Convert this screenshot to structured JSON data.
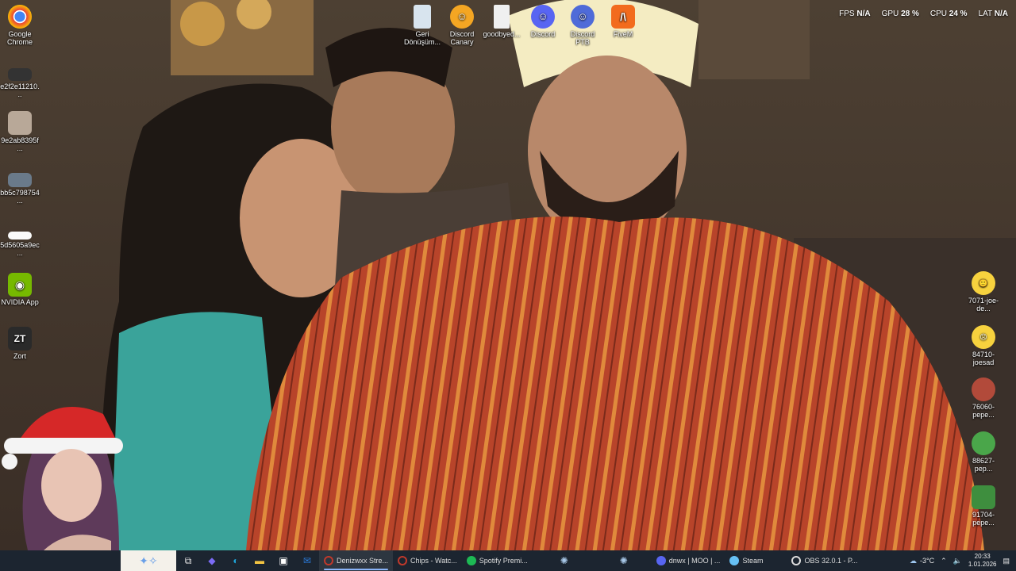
{
  "desktop": {
    "left_icons": [
      {
        "label": "Google Chrome",
        "icon": "chrome-icon"
      },
      {
        "label": "e2f2e11210...",
        "icon": "image-file-icon"
      },
      {
        "label": "9e2ab8395f...",
        "icon": "image-file-icon"
      },
      {
        "label": "bb5c798754...",
        "icon": "image-file-icon"
      },
      {
        "label": "5d5605a9ec...",
        "icon": "image-file-icon"
      },
      {
        "label": "NVIDIA App",
        "icon": "nvidia-icon"
      },
      {
        "label": "Zort",
        "icon": "zort-icon"
      }
    ],
    "top_icons": [
      {
        "label": "Geri Dönüşüm...",
        "icon": "recycle-bin-icon"
      },
      {
        "label": "Discord Canary",
        "icon": "discord-canary-icon"
      },
      {
        "label": "goodbyed...",
        "icon": "file-icon"
      },
      {
        "label": "Discord",
        "icon": "discord-icon"
      },
      {
        "label": "Discord PTB",
        "icon": "discord-ptb-icon"
      },
      {
        "label": "FiveM",
        "icon": "fivem-icon"
      }
    ],
    "right_icons": [
      {
        "label": "7071-joe-de...",
        "icon": "emoji-icon"
      },
      {
        "label": "84710-joesad",
        "icon": "emoji-icon"
      },
      {
        "label": "76060-pepe...",
        "icon": "pepe-icon"
      },
      {
        "label": "88627-pep...",
        "icon": "pepe-icon"
      },
      {
        "label": "91704-pepe...",
        "icon": "pepe-icon"
      }
    ]
  },
  "overlay": {
    "fps_label": "FPS",
    "fps_value": "N/A",
    "gpu_label": "GPU",
    "gpu_value": "28 %",
    "cpu_label": "CPU",
    "cpu_value": "24 %",
    "lat_label": "LAT",
    "lat_value": "N/A"
  },
  "taskbar": {
    "apps": [
      {
        "label": "Denizwxx Stre...",
        "icon": "opera-icon",
        "color": "#c0392b",
        "active": true
      },
      {
        "label": "Chips - Watc...",
        "icon": "opera-icon",
        "color": "#c0392b",
        "active": false
      },
      {
        "label": "Spotify Premi...",
        "icon": "spotify-icon",
        "color": "#1db954",
        "active": false
      },
      {
        "label": "dnwx | MOO | ...",
        "icon": "discord-icon",
        "color": "#5865f2",
        "active": false
      },
      {
        "label": "Steam",
        "icon": "steam-icon",
        "color": "#66c0f4",
        "active": false
      },
      {
        "label": "OBS 32.0.1 - P...",
        "icon": "obs-icon",
        "color": "#dddddd",
        "active": false
      }
    ],
    "weather": "-3°C",
    "time": "20:33",
    "date": "1.01.2026"
  },
  "colors": {
    "taskbar_bg": "#1c2530",
    "accent": "#8ab4f8"
  }
}
